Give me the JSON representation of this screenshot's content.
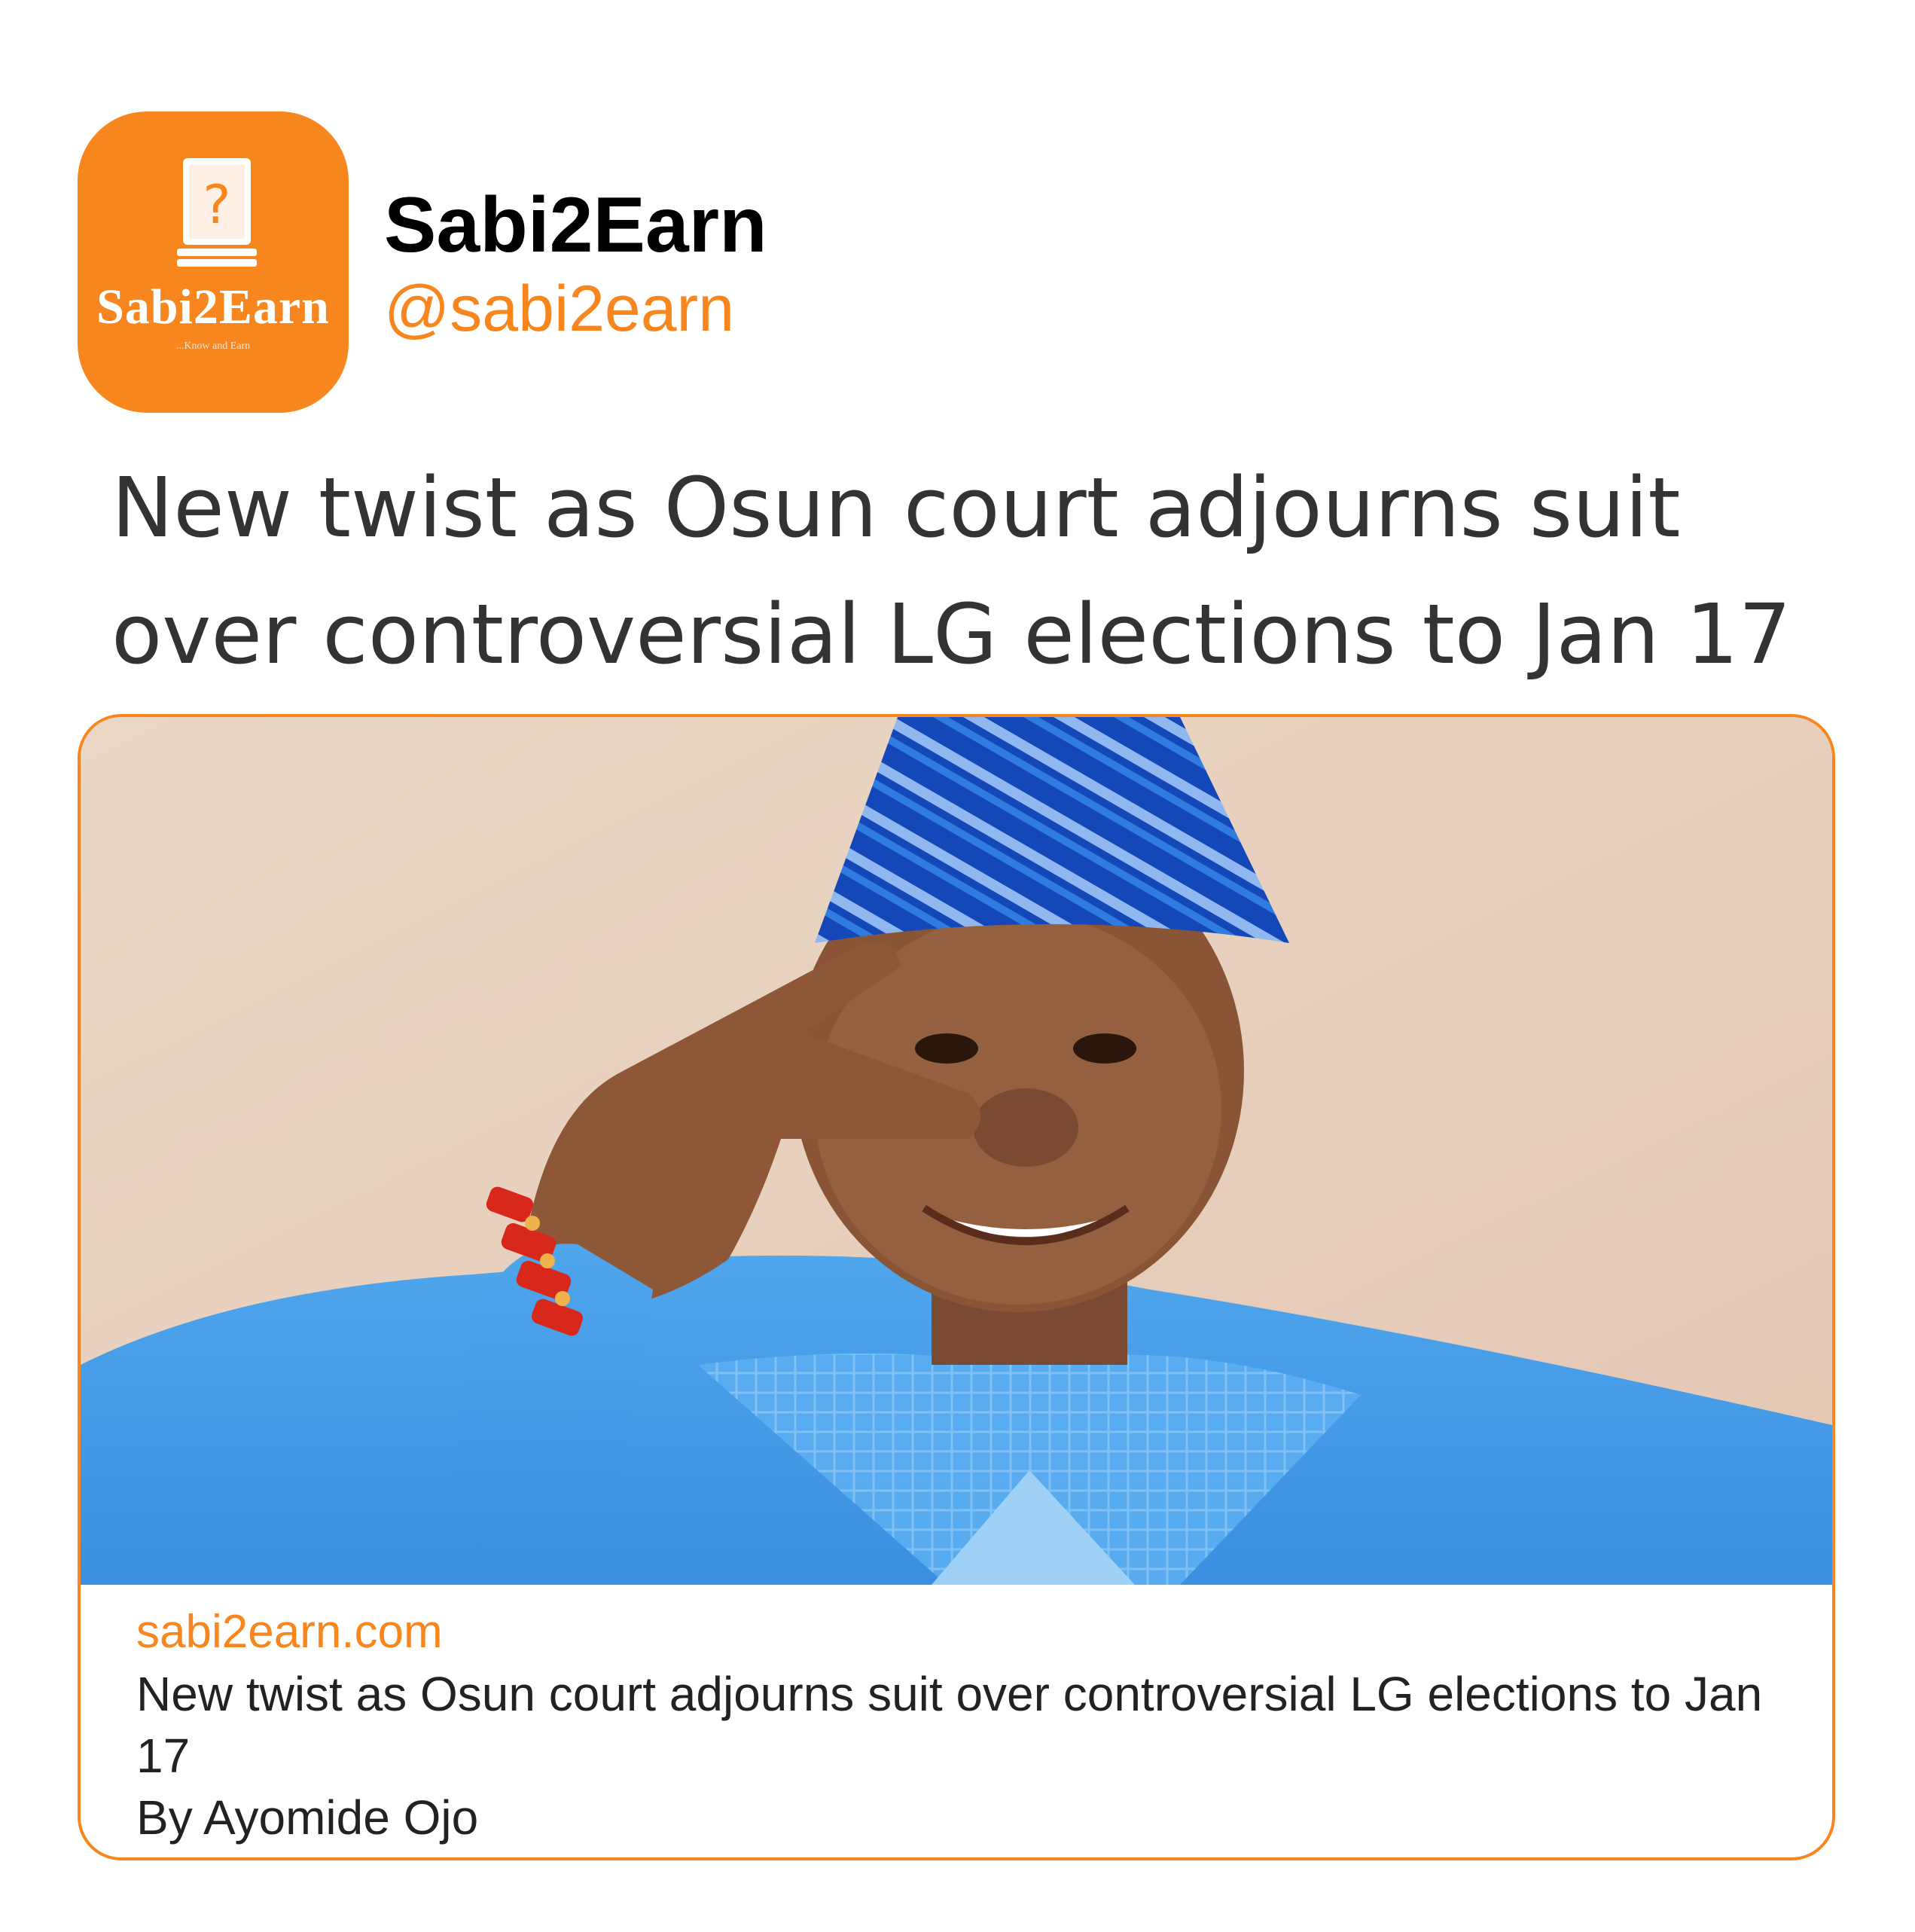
{
  "profile": {
    "display_name": "Sabi2Earn",
    "handle": "@sabi2earn",
    "avatar": {
      "logo_icon": "book-question-mark-icon",
      "wordmark": "Sabi2Earn",
      "tagline": "...Know and Earn",
      "background_color": "#f7861e"
    }
  },
  "tweet": {
    "text": "New twist as Osun court adjourns suit over controversial LG elections to Jan 17"
  },
  "link_card": {
    "image": "photo-man-in-blue-agbada-and-cap",
    "domain": "sabi2earn.com",
    "title": "New twist as Osun court adjourns suit over controversial LG elections to Jan 17",
    "byline": "By Ayomide Ojo",
    "border_color": "#f7861e"
  }
}
